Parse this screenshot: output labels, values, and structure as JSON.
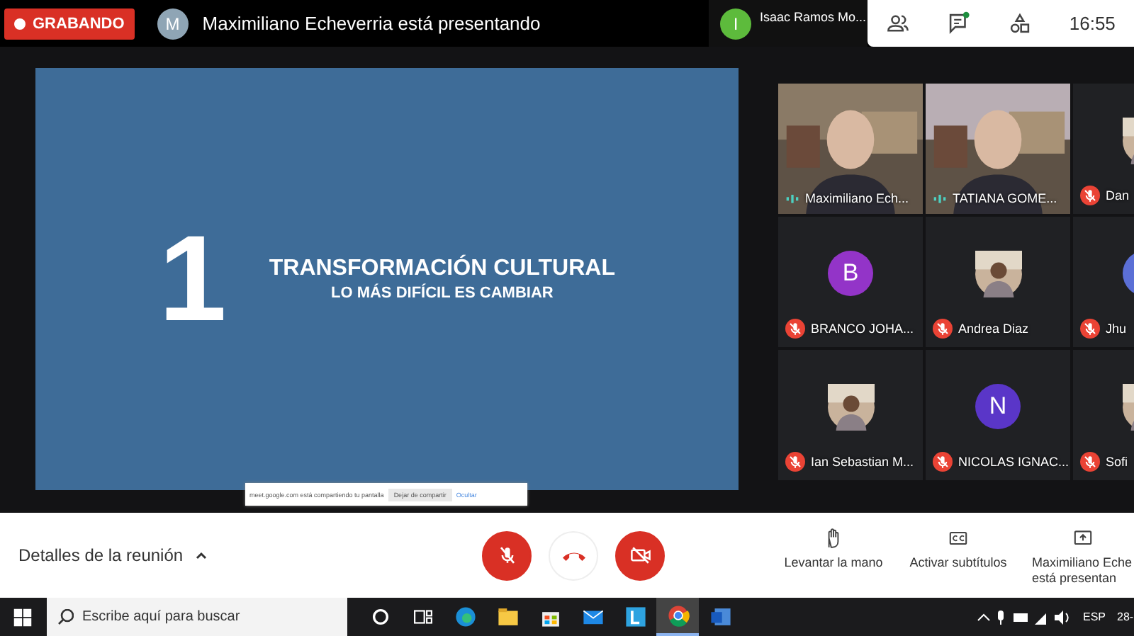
{
  "top_bar": {
    "recording": "GRABANDO",
    "presenter": {
      "initial": "M",
      "text": "Maximiliano Echeverria está presentando"
    },
    "pinned": {
      "initial": "I",
      "name": "Isaac Ramos Mo..."
    },
    "has_new_chat": true,
    "clock": "16:55"
  },
  "slide": {
    "number": "1",
    "title": "TRANSFORMACIÓN CULTURAL",
    "subtitle": "LO MÁS DIFÍCIL ES CAMBIAR"
  },
  "share_bar": {
    "text": "meet.google.com está compartiendo tu pantalla",
    "stop": "Dejar de compartir",
    "hide": "Ocultar"
  },
  "participants": [
    {
      "kind": "video",
      "name": "Maximiliano Ech...",
      "muted": false
    },
    {
      "kind": "video",
      "name": "TATIANA GOME...",
      "muted": false
    },
    {
      "name": "Dan",
      "muted": true
    },
    {
      "kind": "avatar",
      "name": "BRANCO JOHA...",
      "muted": true,
      "initial": "B",
      "color": "#9334c8"
    },
    {
      "name": "Andrea Diaz",
      "muted": true
    },
    {
      "kind": "avatar",
      "name": "Jhu",
      "muted": true,
      "color": "#5b6fd6"
    },
    {
      "name": "Ian Sebastian M...",
      "muted": true
    },
    {
      "kind": "avatar",
      "name": "NICOLAS IGNAC...",
      "muted": true,
      "initial": "N",
      "color": "#5a36c8"
    },
    {
      "name": "Sofi",
      "muted": true
    }
  ],
  "bottom_bar": {
    "details": "Detalles de la reunión",
    "mic_muted": true,
    "camera_off": true,
    "actions": [
      {
        "kind": "hand",
        "lines": [
          "Levantar la mano"
        ]
      },
      {
        "kind": "cc",
        "lines": [
          "Activar subtítulos"
        ]
      },
      {
        "kind": "present",
        "lines": [
          "Maximiliano Eche",
          "está presentan"
        ]
      }
    ]
  },
  "taskbar": {
    "search_placeholder": "Escribe aquí para buscar",
    "apps": [
      {
        "kind": "cortana",
        "selected": false
      },
      {
        "kind": "taskview",
        "selected": false
      },
      {
        "kind": "edge",
        "selected": false
      },
      {
        "kind": "folder",
        "selected": false
      },
      {
        "kind": "store",
        "selected": false
      },
      {
        "kind": "mail",
        "selected": false
      },
      {
        "kind": "l",
        "selected": false
      },
      {
        "kind": "chrome",
        "selected": true
      },
      {
        "kind": "word",
        "selected": false
      }
    ],
    "language": "ESP",
    "date": "28-"
  }
}
